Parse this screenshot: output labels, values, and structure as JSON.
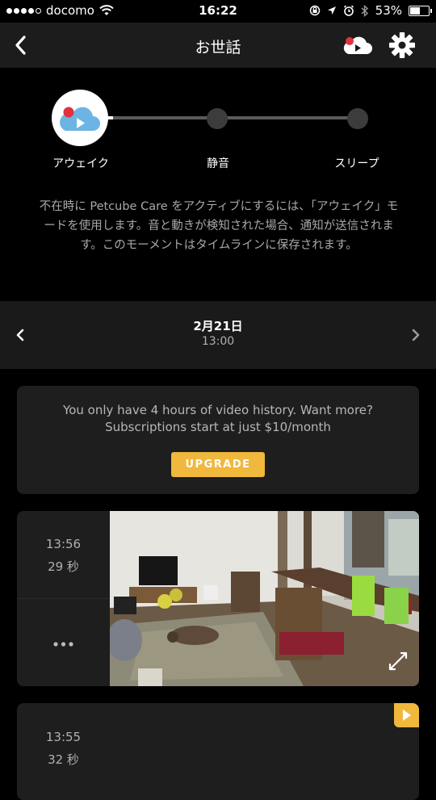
{
  "status_bar": {
    "carrier": "docomo",
    "time": "16:22",
    "battery": "53%",
    "battery_level": 0.53
  },
  "header": {
    "title": "お世話",
    "icons": [
      "back-chevron-icon",
      "cloud-play-icon",
      "gear-icon"
    ]
  },
  "modes": {
    "items": [
      {
        "label": "アウェイク",
        "active": true,
        "icon": "cloud-play-icon"
      },
      {
        "label": "静音",
        "active": false
      },
      {
        "label": "スリープ",
        "active": false
      }
    ],
    "description": "不在時に Petcube Care をアクティブにするには、「アウェイク」モードを使用します。音と動きが検知された場合、通知が送信されます。このモーメントはタイムラインに保存されます。"
  },
  "date_nav": {
    "date": "2月21日",
    "hour": "13:00"
  },
  "promo": {
    "line1": "You only have 4 hours of video history. Want more?",
    "line2": "Subscriptions start at just $10/month",
    "button": "UPGRADE"
  },
  "events": [
    {
      "time": "13:56",
      "duration": "29 秒",
      "more": "•••"
    },
    {
      "time": "13:55",
      "duration": "32 秒"
    }
  ],
  "colors": {
    "accent": "#f0b83c",
    "brand_blue": "#6cb4e4",
    "brand_red": "#e0323c"
  }
}
